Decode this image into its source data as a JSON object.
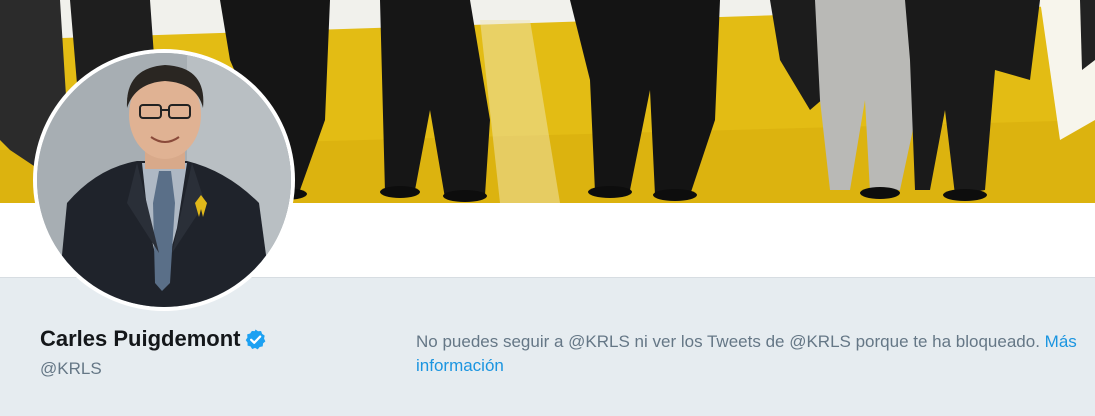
{
  "profile": {
    "name": "Carles Puigdemont",
    "handle": "@KRLS",
    "verified": true,
    "avatar_icon": "profile-photo",
    "banner_icon": "header-photo"
  },
  "blocked_notice": {
    "message": "No puedes seguir a @KRLS ni ver los Tweets de @KRLS porque te ha bloqueado.",
    "link_label": "Más información"
  },
  "colors": {
    "page_background": "#e6ecf0",
    "link": "#1b95e0",
    "verified_badge": "#1da1f2",
    "banner_yellow": "#e3bc14",
    "name_text": "#14171a",
    "muted_text": "#657786"
  }
}
